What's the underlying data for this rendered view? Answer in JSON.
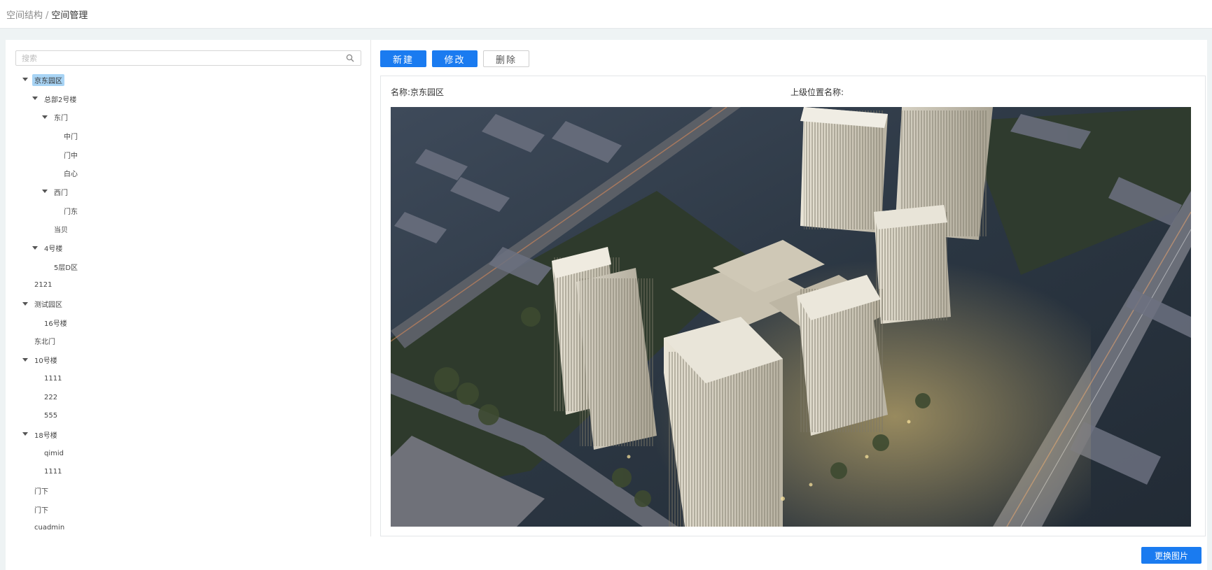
{
  "breadcrumb": {
    "parent": "空间结构",
    "separator": "/",
    "current": "空间管理"
  },
  "search": {
    "placeholder": "搜索",
    "value": ""
  },
  "tree": [
    {
      "label": "京东园区",
      "level": 0,
      "expanded": true,
      "selected": true
    },
    {
      "label": "总部2号楼",
      "level": 1,
      "expanded": true
    },
    {
      "label": "东门",
      "level": 2,
      "expanded": true
    },
    {
      "label": "中门",
      "level": 3
    },
    {
      "label": "门中",
      "level": 3
    },
    {
      "label": "白心",
      "level": 3
    },
    {
      "label": "西门",
      "level": 2,
      "expanded": true
    },
    {
      "label": "门东",
      "level": 3
    },
    {
      "label": "当贝",
      "level": 2
    },
    {
      "label": "4号楼",
      "level": 1,
      "expanded": true
    },
    {
      "label": "5层D区",
      "level": 2
    },
    {
      "label": "2121",
      "level": 0
    },
    {
      "label": "测试园区",
      "level": 0,
      "expanded": true
    },
    {
      "label": "16号楼",
      "level": 1
    },
    {
      "label": "东北门",
      "level": 0
    },
    {
      "label": "10号楼",
      "level": 0,
      "expanded": true
    },
    {
      "label": "1111",
      "level": 1
    },
    {
      "label": "222",
      "level": 1
    },
    {
      "label": "555",
      "level": 1
    },
    {
      "label": "18号楼",
      "level": 0,
      "expanded": true
    },
    {
      "label": "qimid",
      "level": 1
    },
    {
      "label": "1111",
      "level": 1
    },
    {
      "label": "门下",
      "level": 0
    },
    {
      "label": "门下",
      "level": 0
    },
    {
      "label": "cuadmin",
      "level": 0
    }
  ],
  "toolbar": {
    "new_label": "新建",
    "edit_label": "修改",
    "delete_label": "删除"
  },
  "detail": {
    "name_label": "名称:",
    "name_value": "京东园区",
    "parent_label": "上级位置名称:",
    "parent_value": "",
    "image_alt": "aerial-rendering-of-office-park"
  },
  "change_image_label": "更换图片",
  "colors": {
    "primary": "#1a7bf0",
    "selected_bg": "#a8d4f5",
    "page_bg": "#eef3f4"
  }
}
